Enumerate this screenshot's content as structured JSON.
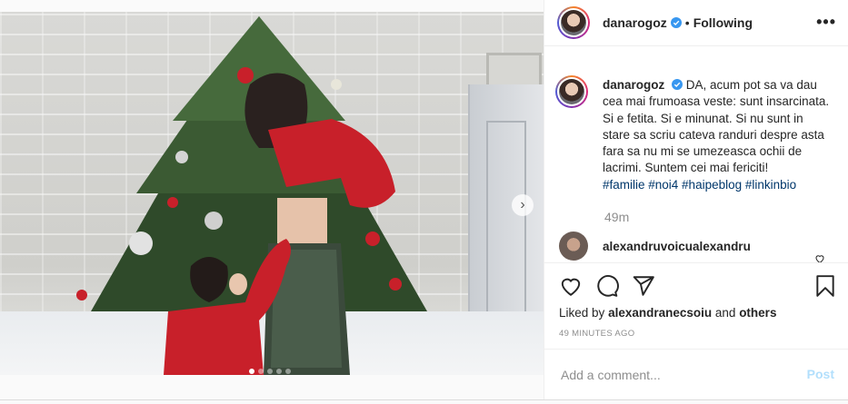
{
  "header": {
    "username": "danarogoz",
    "separator": "•",
    "follow_status": "Following",
    "more_label": "•••"
  },
  "photo": {
    "next_arrow": "›",
    "carousel_count": 5,
    "carousel_active": 0
  },
  "caption": {
    "username": "danarogoz",
    "text": "DA, acum pot sa va dau cea mai frumoasa veste: sunt insarcinata. Si e fetita. Si e minunat. Si nu sunt in stare sa scriu cateva randuri despre asta fara sa nu mi se umezeasca ochii de lacrimi. Suntem cei mai fericiti!",
    "hashtags": "#familie #noi4 #haipeblog #linkinbio",
    "time": "49m"
  },
  "comments": [
    {
      "username": "alexandruvoicualexandru"
    }
  ],
  "actions": {
    "like_icon": "heart-icon",
    "comment_icon": "comment-icon",
    "share_icon": "share-icon",
    "save_icon": "bookmark-icon"
  },
  "likes": {
    "prefix": "Liked by",
    "user": "alexandranecsoiu",
    "and": "and",
    "others": "others"
  },
  "posted_ago": "49 MINUTES AGO",
  "add_comment": {
    "placeholder": "Add a comment...",
    "post_label": "Post"
  },
  "colors": {
    "verified": "#3897f0",
    "hashtag": "#00376b",
    "post_disabled": "#b2dffc",
    "muted": "#8e8e8e",
    "text": "#262626"
  }
}
